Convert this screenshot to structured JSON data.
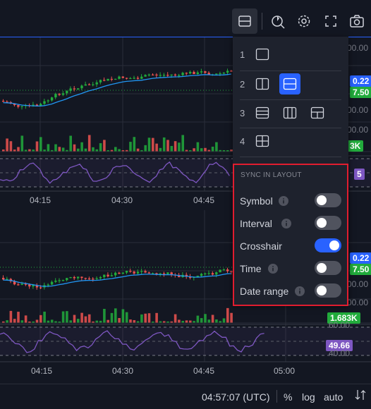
{
  "toolbar": {
    "icons": [
      "layout-icon",
      "replay-icon",
      "settings-icon",
      "fullscreen-icon",
      "camera-icon"
    ]
  },
  "layout_menu": {
    "rows": [
      {
        "number": "1",
        "layouts": [
          "single-layout-icon"
        ]
      },
      {
        "number": "2",
        "layouts": [
          "two-columns-layout-icon",
          "two-rows-layout-icon"
        ],
        "selected": "two-rows-layout-icon"
      },
      {
        "number": "3",
        "layouts": [
          "three-rows-layout-icon",
          "three-columns-layout-icon",
          "one-top-two-bottom-layout-icon"
        ]
      },
      {
        "number": "4",
        "layouts": [
          "grid-2x2-layout-icon"
        ]
      }
    ],
    "sync_title": "SYNC IN LAYOUT",
    "sync_items": [
      {
        "label": "Symbol",
        "state": false
      },
      {
        "label": "Interval",
        "state": false
      },
      {
        "label": "Crosshair",
        "state": true
      },
      {
        "label": "Time",
        "state": false
      },
      {
        "label": "Date range",
        "state": false
      }
    ]
  },
  "pane1": {
    "price_tags": [
      "0.22",
      "7.50"
    ],
    "axis_labels": [
      "00.00",
      "00.00",
      "00.00"
    ],
    "volume_tag": "3K",
    "rsi_tag": "5",
    "time_labels": [
      "04:15",
      "04:30",
      "04:45"
    ]
  },
  "pane2": {
    "price_tags": [
      "0.22",
      "7.50"
    ],
    "axis_labels": [
      "00.00",
      "00.00"
    ],
    "volume_tag": "1.683K",
    "rsi_tag": "49.66",
    "rsi_levels": [
      "60.00",
      "40.00"
    ],
    "time_labels": [
      "04:15",
      "04:30",
      "04:45",
      "05:00"
    ]
  },
  "statusbar": {
    "time": "04:57:07 (UTC)",
    "percent": "%",
    "log": "log",
    "auto": "auto"
  },
  "colors": {
    "up": "#26a69a",
    "up_bright": "#22ab3c",
    "down": "#ef5350",
    "ma": "#2196f3",
    "rsi": "#7e57c2",
    "accent": "#2962ff",
    "highlight_border": "#e11d2f"
  }
}
